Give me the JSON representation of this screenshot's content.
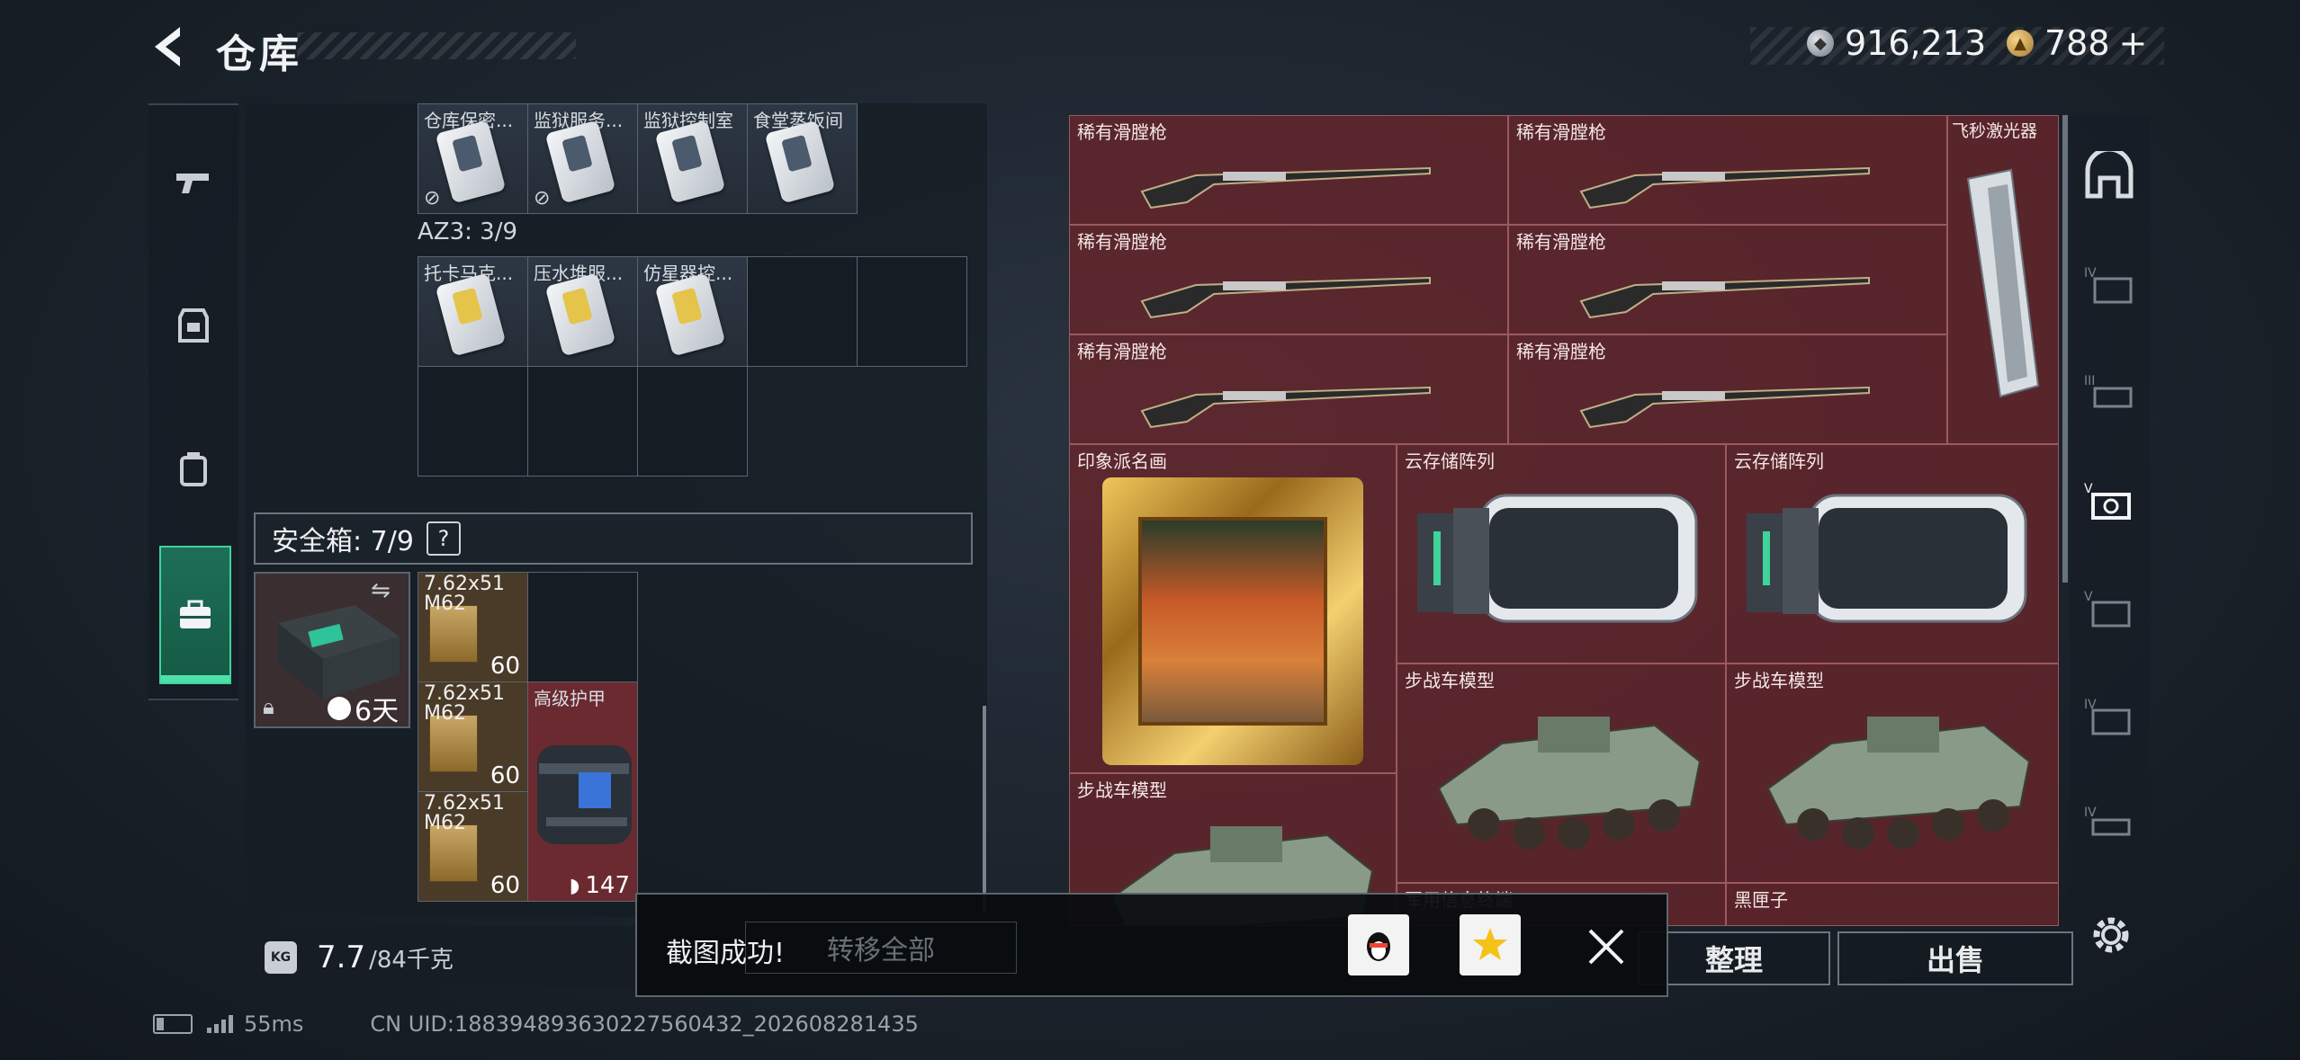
{
  "header": {
    "title": "仓库"
  },
  "currency": {
    "silver": "916,213",
    "gold": "788",
    "gold_add": "+"
  },
  "keys_row1": [
    "仓库保密...",
    "监狱服务...",
    "监狱控制室",
    "食堂蒸饭间"
  ],
  "az3_label": "AZ3: 3/9",
  "keys_row2": [
    "托卡马克...",
    "压水堆服...",
    "仿星器控..."
  ],
  "safe": {
    "label": "安全箱: 7/9",
    "help": "?",
    "timer": "6天"
  },
  "ammo": [
    {
      "name": "7.62x51\nM62",
      "count": "60"
    },
    {
      "name": "7.62x51\nM62",
      "count": "60"
    },
    {
      "name": "7.62x51\nM62",
      "count": "60"
    }
  ],
  "armor": {
    "name": "高级护甲",
    "durability": "147"
  },
  "weight": {
    "value": "7.7",
    "unit": "/84千克"
  },
  "stash": {
    "rifles": [
      "稀有滑膛枪",
      "稀有滑膛枪",
      "稀有滑膛枪",
      "稀有滑膛枪",
      "稀有滑膛枪",
      "稀有滑膛枪"
    ],
    "laser": "飞秒激光器",
    "painting": "印象派名画",
    "servers": [
      "云存储阵列",
      "云存储阵列"
    ],
    "ifvs": [
      "步战车模型",
      "步战车模型",
      "步战车模型"
    ],
    "partial1": "军用信息终端",
    "partial2": "黑匣子"
  },
  "actions": {
    "transfer_all": "转移全部",
    "sort": "整理",
    "sell": "出售"
  },
  "toast": {
    "text": "截图成功!"
  },
  "status": {
    "ping": "55ms",
    "uid": "CN UID:18839489363022756043​2_202608281435"
  },
  "colors": {
    "accent": "#3fd39a",
    "stash_bg": "#7a2a30"
  }
}
